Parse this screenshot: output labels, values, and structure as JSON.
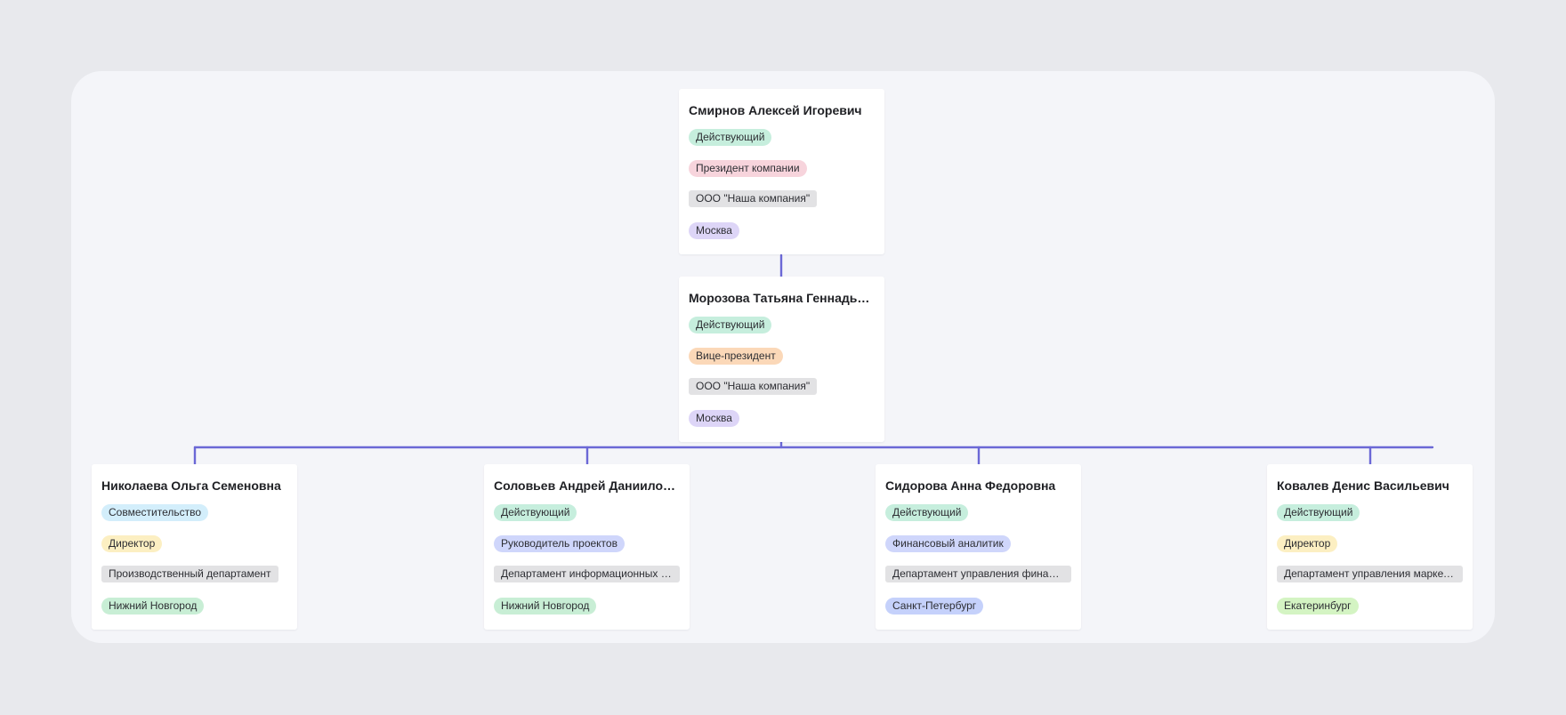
{
  "colors": {
    "connector": "#6b68d6",
    "status_active": "#c6eedd",
    "status_parttime": "#d3eefb",
    "role_president": "#f7d4dc",
    "role_vice": "#fbd8b8",
    "role_director": "#fcefc2",
    "role_pm": "#cfd6fb",
    "role_analyst": "#cfd6fb",
    "org_chip": "#e2e2e4",
    "city_moscow": "#ddd5f7",
    "city_nn": "#c8eed5",
    "city_spb": "#c5d1fb",
    "city_ekb": "#d4f4c3"
  },
  "nodes": [
    {
      "name": "Смирнов Алексей Игоревич",
      "status": "Действующий",
      "status_color": "#c6eedd",
      "role": "Президент компании",
      "role_color": "#f7d4dc",
      "org": "ООО \"Наша компания\"",
      "city": "Москва",
      "city_color": "#ddd5f7"
    },
    {
      "name": "Морозова Татьяна Геннадьевна",
      "status": "Действующий",
      "status_color": "#c6eedd",
      "role": "Вице-президент",
      "role_color": "#fbd8b8",
      "org": "ООО \"Наша компания\"",
      "city": "Москва",
      "city_color": "#ddd5f7"
    },
    {
      "name": "Николаева Ольга Семеновна",
      "status": "Совместительство",
      "status_color": "#d3eefb",
      "role": "Директор",
      "role_color": "#fcefc2",
      "org": "Производственный департамент",
      "city": "Нижний Новгород",
      "city_color": "#c8eed5"
    },
    {
      "name": "Соловьев Андрей Даниилович",
      "status": "Действующий",
      "status_color": "#c6eedd",
      "role": "Руководитель проектов",
      "role_color": "#cfd6fb",
      "org": "Департамент информационных технологий",
      "city": "Нижний Новгород",
      "city_color": "#c8eed5"
    },
    {
      "name": "Сидорова Анна Федоровна",
      "status": "Действующий",
      "status_color": "#c6eedd",
      "role": "Финансовый аналитик",
      "role_color": "#cfd6fb",
      "org": "Департамент управления финансами",
      "city": "Санкт-Петербург",
      "city_color": "#c5d1fb"
    },
    {
      "name": "Ковалев Денис Васильевич",
      "status": "Действующий",
      "status_color": "#c6eedd",
      "role": "Директор",
      "role_color": "#fcefc2",
      "org": "Департамент управления маркетингом",
      "city": "Екатеринбург",
      "city_color": "#d4f4c3"
    }
  ]
}
